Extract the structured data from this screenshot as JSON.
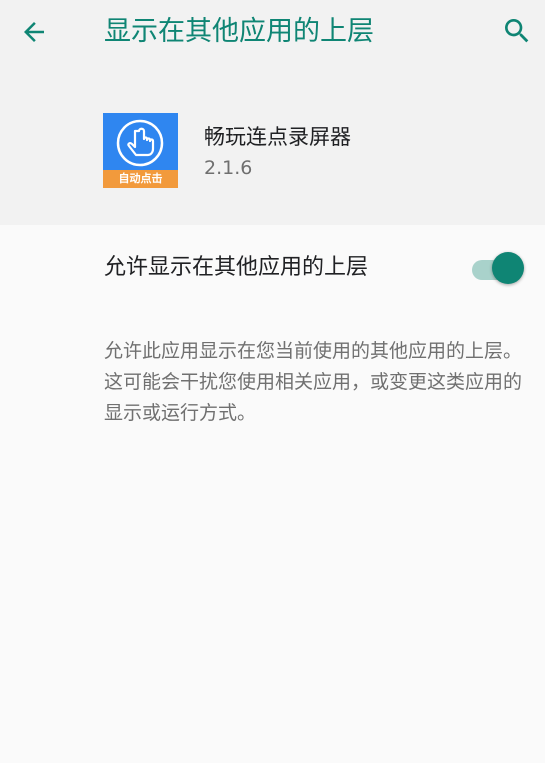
{
  "header": {
    "title": "显示在其他应用的上层",
    "back_icon": "arrow-left-icon",
    "search_icon": "search-icon",
    "accent_color": "#0f8574",
    "background_color": "#f2f2f2"
  },
  "app": {
    "name": "畅玩连点录屏器",
    "version": "2.1.6",
    "icon_label": "自动点击",
    "icon_name": "hand-pointer-icon",
    "icon_color": "#2f86f0",
    "icon_label_color": "#f29a3c"
  },
  "setting": {
    "label": "允许显示在其他应用的上层",
    "enabled": true,
    "switch_on_color": "#0f8574"
  },
  "description": {
    "text": "允许此应用显示在您当前使用的其他应用的上层。这可能会干扰您使用相关应用，或变更这类应用的显示或运行方式。"
  }
}
